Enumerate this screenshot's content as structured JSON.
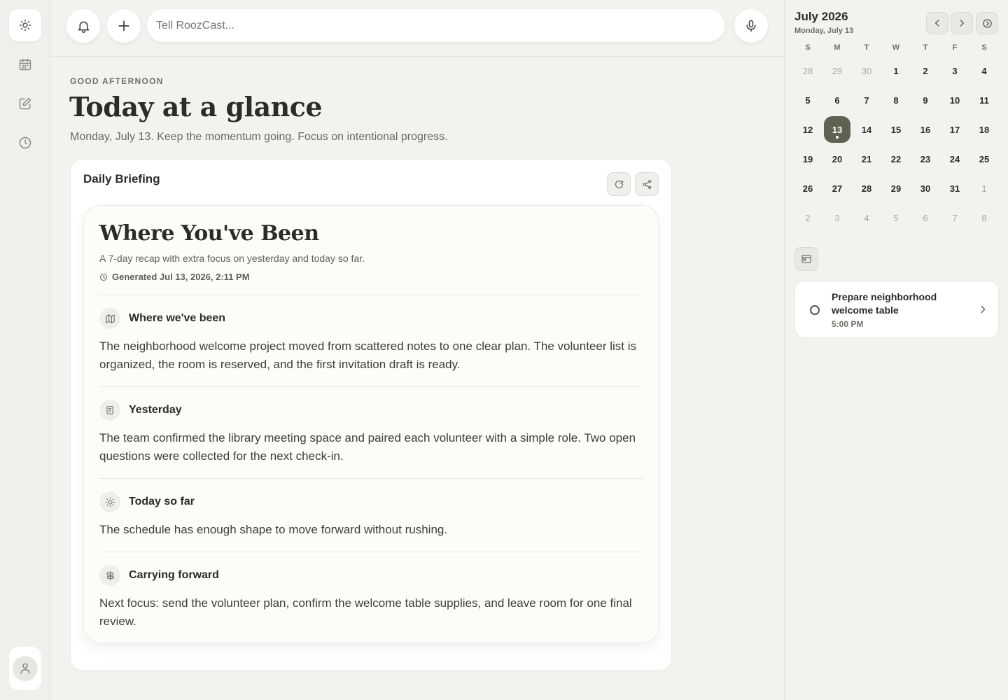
{
  "rail": {
    "items": [
      {
        "icon": "sun-icon",
        "active": true
      },
      {
        "icon": "calendar-icon",
        "active": false
      },
      {
        "icon": "edit-icon",
        "active": false
      },
      {
        "icon": "clock-icon",
        "active": false
      }
    ],
    "avatar_icon": "user-icon"
  },
  "topbar": {
    "search_placeholder": "Tell RoozCast...",
    "search_value": ""
  },
  "main": {
    "greeting": "GOOD AFTERNOON",
    "title": "Today at a glance",
    "subtitle": "Monday, July 13. Keep the momentum going. Focus on intentional progress."
  },
  "briefing": {
    "title": "Daily Briefing",
    "heading": "Where You've Been",
    "description": "A 7-day recap with extra focus on yesterday and today so far.",
    "generated": "Generated Jul 13, 2026, 2:11 PM",
    "sections": [
      {
        "icon": "map-icon",
        "label": "Where we've been",
        "body": "The neighborhood welcome project moved from scattered notes to one clear plan. The volunteer list is organized, the room is reserved, and the first invitation draft is ready."
      },
      {
        "icon": "document-icon",
        "label": "Yesterday",
        "body": "The team confirmed the library meeting space and paired each volunteer with a simple role. Two open questions were collected for the next check-in."
      },
      {
        "icon": "sun-icon",
        "label": "Today so far",
        "body": "The schedule has enough shape to move forward without rushing."
      },
      {
        "icon": "signpost-icon",
        "label": "Carrying forward",
        "body": "Next focus: send the volunteer plan, confirm the welcome table supplies, and leave room for one final review."
      }
    ]
  },
  "calendar": {
    "month": "July 2026",
    "selected_label": "Monday, July 13",
    "weekdays": [
      "S",
      "M",
      "T",
      "W",
      "T",
      "F",
      "S"
    ],
    "weeks": [
      [
        "28",
        "29",
        "30",
        "1",
        "2",
        "3",
        "4"
      ],
      [
        "5",
        "6",
        "7",
        "8",
        "9",
        "10",
        "11"
      ],
      [
        "12",
        "13",
        "14",
        "15",
        "16",
        "17",
        "18"
      ],
      [
        "19",
        "20",
        "21",
        "22",
        "23",
        "24",
        "25"
      ],
      [
        "26",
        "27",
        "28",
        "29",
        "30",
        "31",
        "1"
      ],
      [
        "2",
        "3",
        "4",
        "5",
        "6",
        "7",
        "8"
      ]
    ],
    "today": "13",
    "accent": "#5d6350"
  },
  "event": {
    "title": "Prepare neighborhood welcome table",
    "time": "5:00 PM"
  }
}
